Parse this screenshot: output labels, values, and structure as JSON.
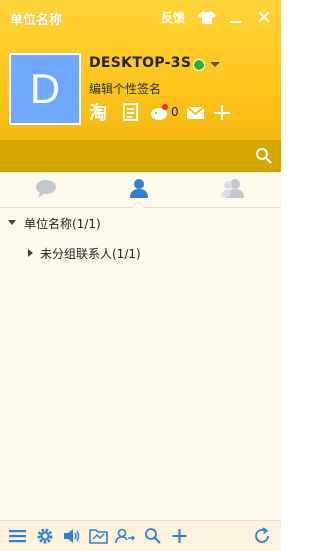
{
  "titlebar": {
    "app_title": "单位名称",
    "feedback_label": "反馈"
  },
  "profile": {
    "avatar_letter": "D",
    "nickname": "DESKTOP-3S",
    "signature": "编辑个性签名",
    "pet_count": "0",
    "status": "online"
  },
  "tabs": [
    "chat-bubble-icon",
    "contacts-icon",
    "groups-icon"
  ],
  "tree": {
    "group_label": "单位名称(1/1)",
    "subgroup_label": "未分组联系人(1/1)"
  },
  "colors": {
    "header_yellow": "#ffc71f",
    "searchbar": "#d6a600",
    "accent_blue": "#2f7fd6",
    "body_bg": "#fdf9ec"
  }
}
